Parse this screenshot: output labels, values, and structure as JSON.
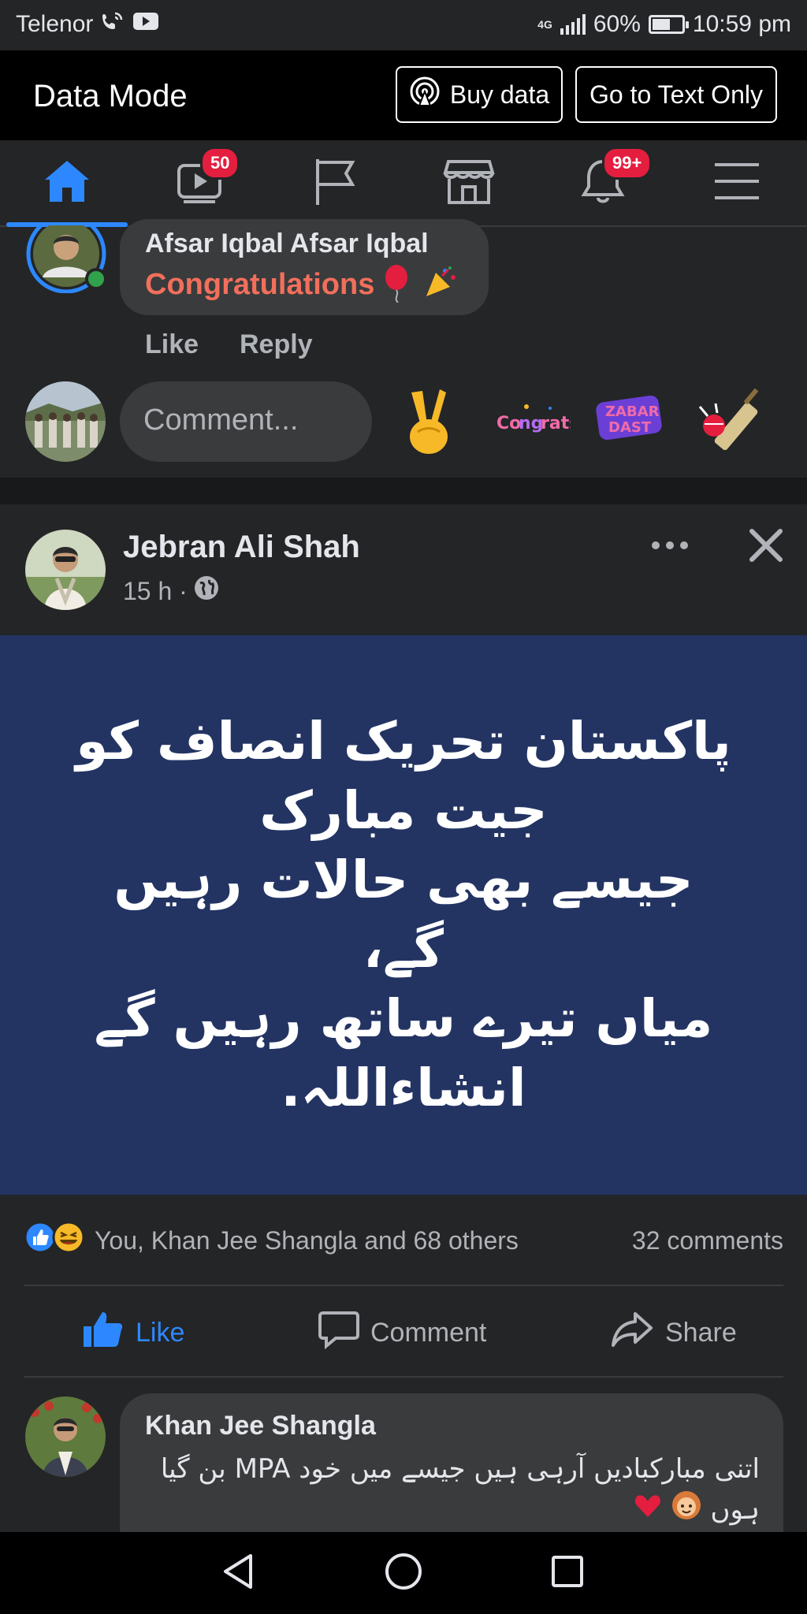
{
  "status": {
    "carrier": "Telenor",
    "network": "4G",
    "battery": "60%",
    "battery_level": 0.6,
    "time": "10:59 pm"
  },
  "databar": {
    "title": "Data Mode",
    "buy_label": "Buy data",
    "text_only_label": "Go to Text Only"
  },
  "nav": {
    "video_badge": "50",
    "notifications_badge": "99+"
  },
  "comment1": {
    "author": "Afsar Iqbal Afsar Iqbal",
    "text": "Congratulations",
    "like": "Like",
    "reply": "Reply"
  },
  "composer": {
    "placeholder": "Comment..."
  },
  "post": {
    "author": "Jebran Ali Shah",
    "time": "15 h ·",
    "body": "پاکستان تحریک انصاف کو\nجیت مبارک\nجیسے بھی حالات رہیں گے،\nمیاں تیرے ساتھ رہیں گے\nانشاءاللہ.",
    "reactions_text": "You, Khan Jee Shangla and 68 others",
    "comments_count": "32 comments",
    "like_label": "Like",
    "comment_label": "Comment",
    "share_label": "Share"
  },
  "comment2": {
    "author": "Khan Jee Shangla",
    "text": "اتنی مبارکبادیں آرہی ہیں جیسے میں خود MPA بن گیا ہوں"
  },
  "colors": {
    "accent": "#2d88ff",
    "badge": "#e41e3f",
    "banner": "#233463",
    "congrats": "#f26f5c"
  }
}
